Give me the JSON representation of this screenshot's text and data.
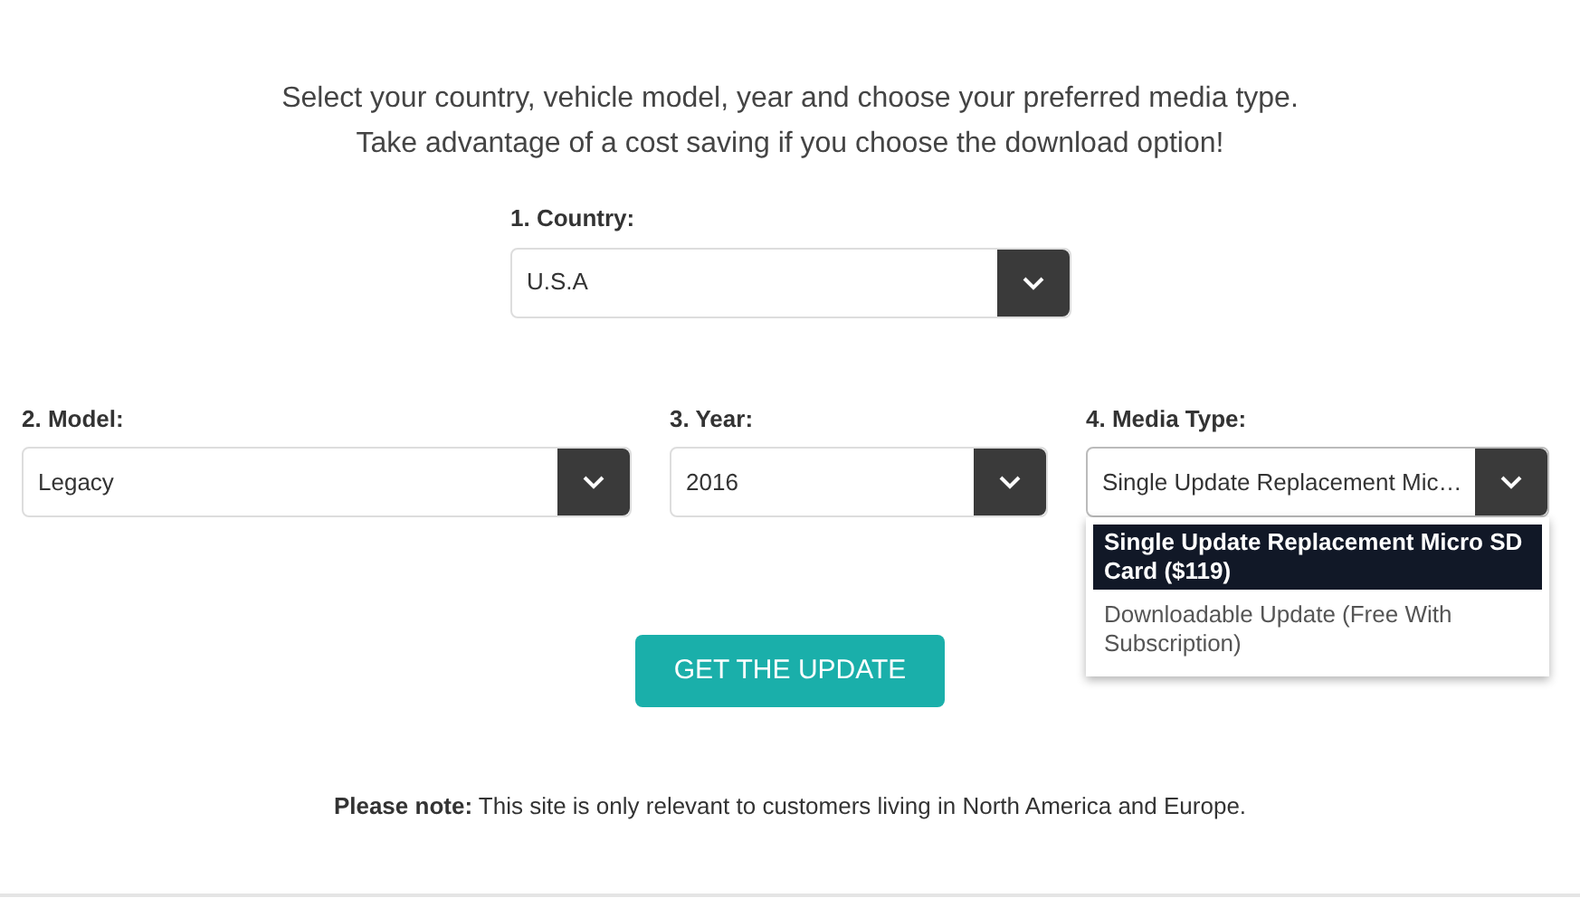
{
  "intro": [
    "Select your country, vehicle model, year and choose your preferred media type.",
    "Take advantage of a cost saving if you choose the download option!"
  ],
  "country": {
    "label": "1. Country:",
    "value": "U.S.A"
  },
  "fields": [
    {
      "label": "2. Model:",
      "value": "Legacy"
    },
    {
      "label": "3. Year:",
      "value": "2016"
    },
    {
      "label": "4. Media Type:",
      "value": "Single Update Replacement Mic…",
      "expanded": true,
      "options": [
        {
          "label": "Single Update Replacement Micro SD Card ($119)",
          "selected": true
        },
        {
          "label": "Downloadable Update (Free With Subscription)",
          "selected": false
        }
      ]
    }
  ],
  "button": "GET THE UPDATE",
  "note": "**Please note:** This site is only relevant to customers living in North America and Europe."
}
